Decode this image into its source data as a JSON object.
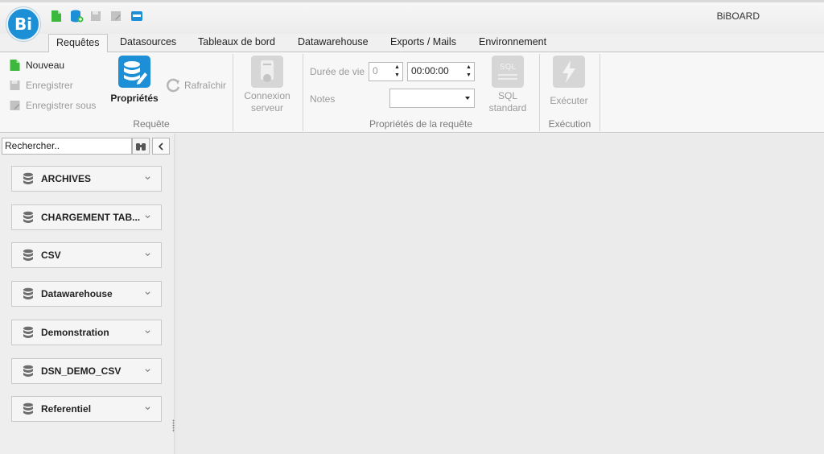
{
  "app": {
    "title": "BiBOARD",
    "logo_text": "Bi"
  },
  "tabs": [
    {
      "label": "Requêtes",
      "active": true
    },
    {
      "label": "Datasources"
    },
    {
      "label": "Tableaux de bord"
    },
    {
      "label": "Datawarehouse"
    },
    {
      "label": "Exports / Mails"
    },
    {
      "label": "Environnement"
    }
  ],
  "ribbon": {
    "requete": {
      "group_label": "Requête",
      "nouveau": "Nouveau",
      "enregistrer": "Enregistrer",
      "enregistrer_sous": "Enregistrer sous",
      "proprietes": "Propriétés",
      "rafraichir": "Rafraîchir",
      "connexion_line1": "Connexion",
      "connexion_line2": "serveur"
    },
    "proprietes_requete": {
      "group_label": "Propriétés de la requête",
      "duree_label": "Durée de vie",
      "duree_value": "0",
      "time_value": "00:00:00",
      "notes_label": "Notes",
      "notes_value": "",
      "sql_line1": "SQL",
      "sql_line2": "standard"
    },
    "execution": {
      "group_label": "Exécution",
      "executer": "Exécuter"
    }
  },
  "sidebar": {
    "search_value": "Rechercher..",
    "items": [
      {
        "label": "ARCHIVES"
      },
      {
        "label": "CHARGEMENT TAB..."
      },
      {
        "label": "CSV"
      },
      {
        "label": "Datawarehouse"
      },
      {
        "label": "Demonstration"
      },
      {
        "label": "DSN_DEMO_CSV"
      },
      {
        "label": "Referentiel"
      }
    ]
  },
  "colors": {
    "accent_blue": "#1d8fd6",
    "new_green": "#3cb83c",
    "disabled_gray": "#9a9a9a"
  },
  "icons": [
    "new-document-icon",
    "add-database-icon",
    "save-icon",
    "save-as-icon",
    "window-icon",
    "properties-icon",
    "refresh-icon",
    "server-connection-icon",
    "sql-icon",
    "execute-icon",
    "binoculars-icon",
    "chevron-left-icon",
    "database-icon",
    "chevron-down-icon"
  ]
}
